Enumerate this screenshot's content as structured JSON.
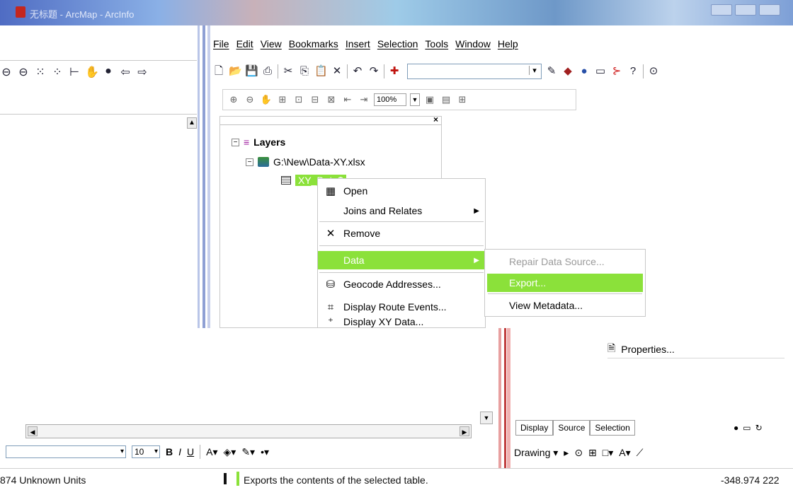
{
  "window": {
    "title": "无标题 - ArcMap - ArcInfo"
  },
  "menubar": [
    "File",
    "Edit",
    "View",
    "Bookmarks",
    "Insert",
    "Selection",
    "Tools",
    "Window",
    "Help"
  ],
  "layout_toolbar": {
    "zoom_value": "100%"
  },
  "toc": {
    "root_label": "Layers",
    "source_label": "G:\\New\\Data-XY.xlsx",
    "table_label": "XY_Data$"
  },
  "context_menu": {
    "items": [
      {
        "label": "Open",
        "icon": "table-icon"
      },
      {
        "label": "Joins and Relates",
        "icon": "",
        "has_submenu": true
      },
      {
        "label": "Remove",
        "icon": "remove-x-icon"
      },
      {
        "label": "Data",
        "icon": "",
        "has_submenu": true,
        "highlighted": true
      },
      {
        "label": "Geocode Addresses...",
        "icon": "geocode-icon"
      },
      {
        "label": "Display Route Events...",
        "icon": "route-events-icon"
      },
      {
        "label": "Display XY Data...",
        "icon": "xy-data-icon"
      }
    ]
  },
  "data_submenu": {
    "items": [
      {
        "label": "Repair Data Source...",
        "disabled": true
      },
      {
        "label": "Export...",
        "highlighted": true
      },
      {
        "label": "View Metadata..."
      }
    ]
  },
  "properties_item": {
    "label": "Properties..."
  },
  "toc_tabs": [
    "Display",
    "Source",
    "Selection"
  ],
  "drawing": {
    "font_size": "10",
    "drawing_label": "Drawing"
  },
  "statusbar": {
    "left": "874 Unknown Units",
    "message": "Exports the contents of the selected table.",
    "right": "-348.974  222"
  },
  "colors": {
    "highlight": "#8be13a",
    "title_gradient_start": "#4f6cc3"
  }
}
